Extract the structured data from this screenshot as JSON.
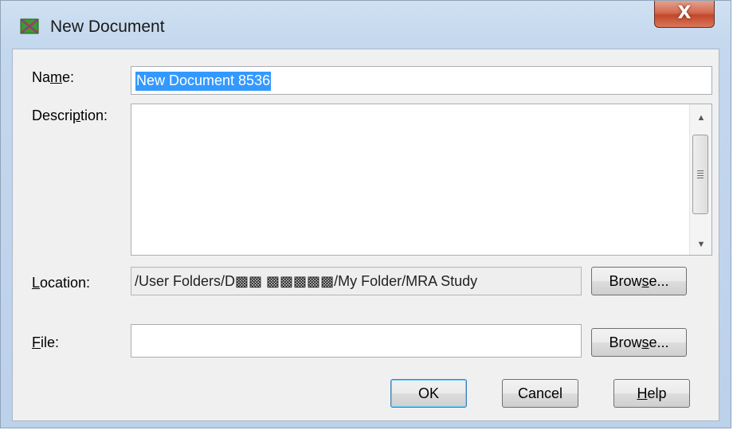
{
  "window": {
    "title": "New Document",
    "close_glyph": "X"
  },
  "icons": {
    "app": "new-document-app-icon",
    "close": "close-icon"
  },
  "form": {
    "name_label": [
      "Na",
      "m",
      "e:"
    ],
    "name_value": "New Document 8536",
    "description_label": [
      "Descri",
      "p",
      "tion:"
    ],
    "description_value": "",
    "location_label": [
      "",
      "L",
      "ocation:"
    ],
    "location_value": "/User Folders/D▩▩ ▩▩▩▩▩/My Folder/MRA Study",
    "file_label": [
      "",
      "F",
      "ile:"
    ],
    "file_value": ""
  },
  "buttons": {
    "browse_location": [
      "Brow",
      "s",
      "e..."
    ],
    "browse_file": [
      "Brow",
      "s",
      "e..."
    ],
    "ok": "OK",
    "cancel": "Cancel",
    "help": [
      "",
      "H",
      "elp"
    ]
  },
  "colors": {
    "selection": "#3399ff",
    "close_button": "#c7472b",
    "title_bar": "#c3d7ee"
  }
}
